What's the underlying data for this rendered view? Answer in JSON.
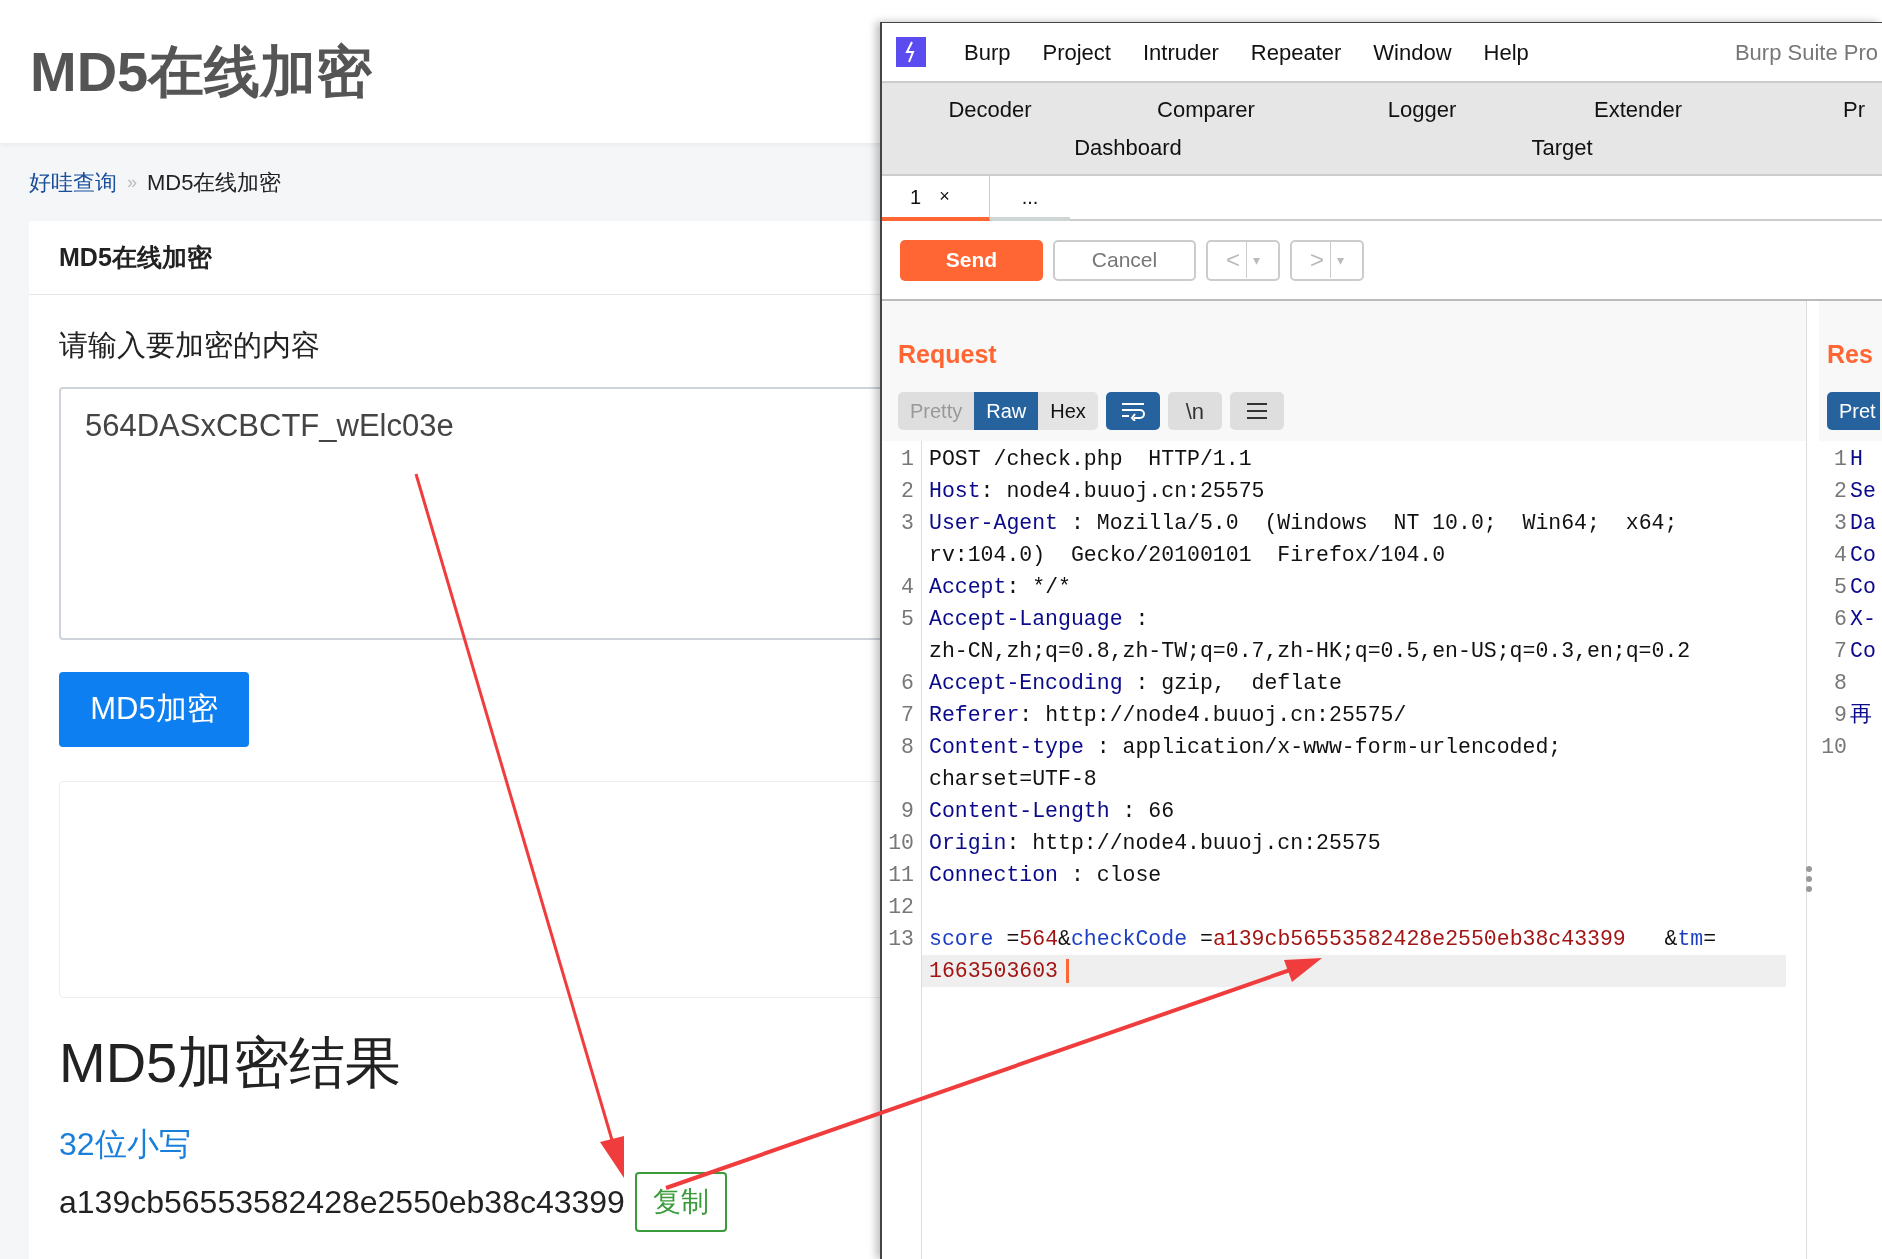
{
  "page": {
    "title": "MD5在线加密",
    "breadcrumb": [
      {
        "label": "好哇查询",
        "kind": "link"
      },
      {
        "label": "»",
        "kind": "separator"
      },
      {
        "label": "MD5在线加密",
        "kind": "current"
      }
    ],
    "card_title": "MD5在线加密",
    "input_label": "请输入要加密的内容",
    "input_value": "564DASxCBCTF_wElc03e",
    "encrypt_button": "MD5加密",
    "result_title": "MD5加密结果",
    "result_label": "32位小写",
    "result_value": "a139cb56553582428e2550eb38c43399",
    "copy_button": "复制"
  },
  "burp": {
    "menu": [
      "Burp",
      "Project",
      "Intruder",
      "Repeater",
      "Window",
      "Help"
    ],
    "app_title": "Burp Suite Pro",
    "tool_tabs": [
      [
        "Decoder",
        "Comparer",
        "Logger",
        "Extender",
        "Pr"
      ],
      [
        "Dashboard",
        "Target"
      ]
    ],
    "repeater_tabs": [
      {
        "label": "1",
        "close": "×",
        "selected": true
      },
      {
        "label": "...",
        "selected": false
      }
    ],
    "send": "Send",
    "cancel": "Cancel",
    "nav_buttons": [
      {
        "label": "<",
        "dropdown": "▾",
        "disabled": true
      },
      {
        "label": ">",
        "dropdown": "▾",
        "disabled": true
      }
    ],
    "request": {
      "title": "Request",
      "views": [
        {
          "label": "Pretty",
          "selected": false
        },
        {
          "label": "Raw",
          "selected": true
        },
        {
          "label": "Hex",
          "selected": false
        }
      ],
      "tools": [
        {
          "kind": "wrap",
          "on": true
        },
        {
          "kind": "newline",
          "label": "\\n",
          "on": false
        },
        {
          "kind": "menu",
          "on": false
        }
      ],
      "lines": [
        {
          "number": "1",
          "rows": [
            [
              {
                "kind": "text",
                "text": "POST /check.php  HTTP/1.1"
              }
            ]
          ]
        },
        {
          "number": "2",
          "rows": [
            [
              {
                "kind": "name",
                "text": "Host"
              },
              {
                "kind": "text",
                "text": ": node4.buuoj.cn:25575"
              }
            ]
          ]
        },
        {
          "number": "3",
          "rows": [
            [
              {
                "kind": "name",
                "text": "User-Agent"
              },
              {
                "kind": "text",
                "text": " : Mozilla/5.0  (Windows  NT 10.0;  Win64;  x64;"
              }
            ],
            [
              {
                "kind": "text",
                "text": "rv:104.0)  Gecko/20100101  Firefox/104.0"
              }
            ]
          ]
        },
        {
          "number": "4",
          "rows": [
            [
              {
                "kind": "name",
                "text": "Accept"
              },
              {
                "kind": "text",
                "text": ": */*"
              }
            ]
          ]
        },
        {
          "number": "5",
          "rows": [
            [
              {
                "kind": "name",
                "text": "Accept-Language"
              },
              {
                "kind": "text",
                "text": " :"
              }
            ],
            [
              {
                "kind": "text",
                "text": "zh-CN,zh;q=0.8,zh-TW;q=0.7,zh-HK;q=0.5,en-US;q=0.3,en;q=0.2"
              }
            ]
          ]
        },
        {
          "number": "6",
          "rows": [
            [
              {
                "kind": "name",
                "text": "Accept-Encoding"
              },
              {
                "kind": "text",
                "text": " : gzip,  deflate"
              }
            ]
          ]
        },
        {
          "number": "7",
          "rows": [
            [
              {
                "kind": "name",
                "text": "Referer"
              },
              {
                "kind": "text",
                "text": ": http://node4.buuoj.cn:25575/"
              }
            ]
          ]
        },
        {
          "number": "8",
          "rows": [
            [
              {
                "kind": "name",
                "text": "Content-type"
              },
              {
                "kind": "text",
                "text": " : application/x-www-form-urlencoded;"
              }
            ],
            [
              {
                "kind": "text",
                "text": "charset=UTF-8"
              }
            ]
          ]
        },
        {
          "number": "9",
          "rows": [
            [
              {
                "kind": "name",
                "text": "Content-Length"
              },
              {
                "kind": "text",
                "text": " : 66"
              }
            ]
          ]
        },
        {
          "number": "10",
          "rows": [
            [
              {
                "kind": "name",
                "text": "Origin"
              },
              {
                "kind": "text",
                "text": ": http://node4.buuoj.cn:25575"
              }
            ]
          ]
        },
        {
          "number": "11",
          "rows": [
            [
              {
                "kind": "name",
                "text": "Connection"
              },
              {
                "kind": "text",
                "text": " : close"
              }
            ]
          ]
        },
        {
          "number": "12",
          "rows": [
            []
          ]
        },
        {
          "number": "13",
          "current": true,
          "rows": [
            [
              {
                "kind": "param",
                "text": "score"
              },
              {
                "kind": "text",
                "text": " ="
              },
              {
                "kind": "value",
                "text": "564"
              },
              {
                "kind": "text",
                "text": "&"
              },
              {
                "kind": "param",
                "text": "checkCode"
              },
              {
                "kind": "text",
                "text": " ="
              },
              {
                "kind": "value",
                "text": "a139cb56553582428e2550eb38c43399"
              },
              {
                "kind": "text",
                "text": "   &"
              },
              {
                "kind": "param",
                "text": "tm"
              },
              {
                "kind": "text",
                "text": "="
              }
            ],
            [
              {
                "kind": "value",
                "text": "1663503603"
              }
            ]
          ]
        }
      ]
    },
    "response": {
      "title": "Res",
      "views": [
        {
          "label": "Pret",
          "selected": true
        }
      ],
      "lines": [
        {
          "number": "1",
          "text": "H"
        },
        {
          "number": "2",
          "text": "Se"
        },
        {
          "number": "3",
          "text": "Da"
        },
        {
          "number": "4",
          "text": "Co"
        },
        {
          "number": "5",
          "text": "Co"
        },
        {
          "number": "6",
          "text": "X-"
        },
        {
          "number": "7",
          "text": "Co"
        },
        {
          "number": "8"
        },
        {
          "number": "9",
          "text": "再"
        },
        {
          "number": "10"
        }
      ]
    }
  }
}
